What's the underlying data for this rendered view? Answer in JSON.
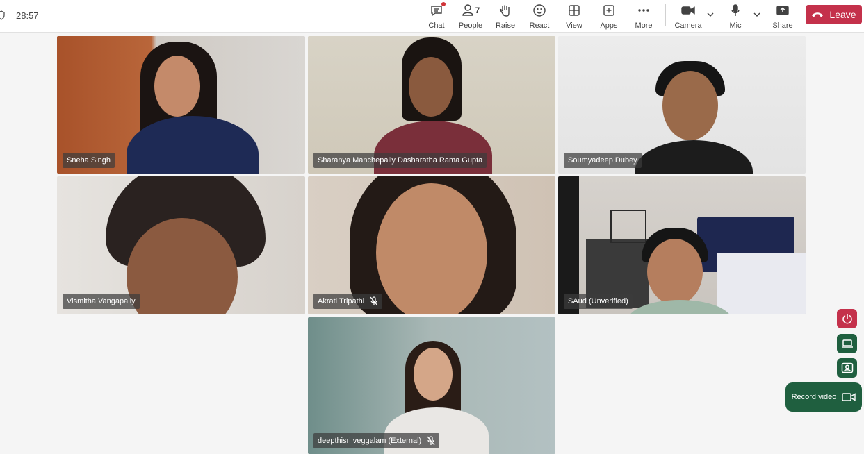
{
  "meeting": {
    "elapsed": "28:57"
  },
  "toolbar": {
    "chat": "Chat",
    "people": "People",
    "people_count": "7",
    "raise": "Raise",
    "react": "React",
    "view": "View",
    "apps": "Apps",
    "more": "More",
    "camera": "Camera",
    "mic": "Mic",
    "share": "Share",
    "leave": "Leave",
    "leave_color": "#c4314b"
  },
  "participants": [
    {
      "name": "Sneha Singh",
      "muted": false
    },
    {
      "name": "Sharanya Manchepally Dasharatha Rama Gupta",
      "muted": false
    },
    {
      "name": "Soumyadeep Dubey",
      "muted": false
    },
    {
      "name": "Vismitha Vangapally",
      "muted": false
    },
    {
      "name": "Akrati Tripathi",
      "muted": true
    },
    {
      "name": "SAud (Unverified)",
      "muted": false
    },
    {
      "name": "deepthisri veggalam (External)",
      "muted": true
    }
  ],
  "side_controls": {
    "record_label": "Record video",
    "accent": "#1f5f3f"
  }
}
